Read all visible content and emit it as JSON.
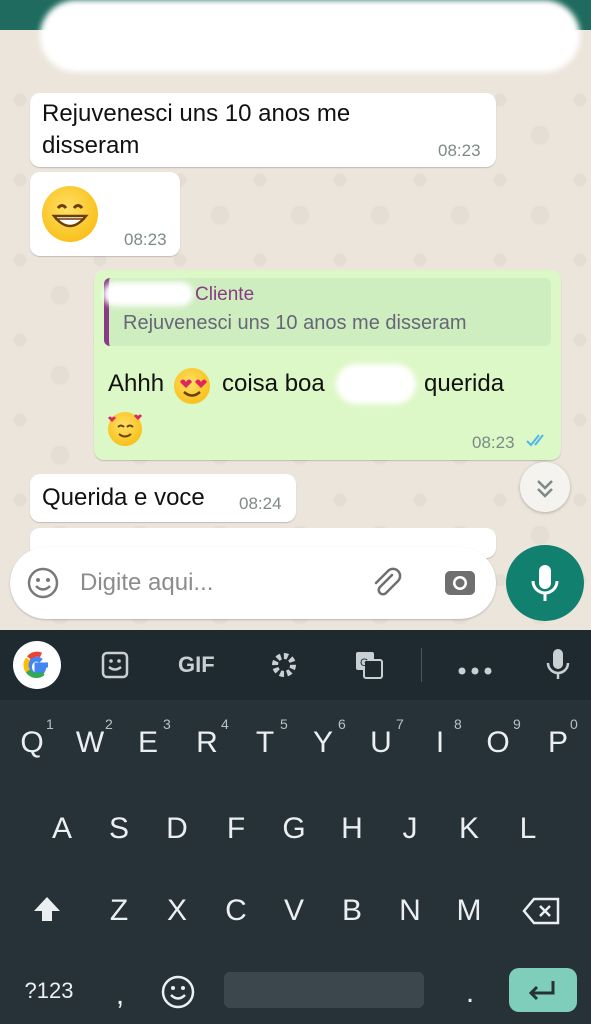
{
  "messages": [
    {
      "text": "Rejuvenesci uns 10 anos me disseram",
      "time": "08:23"
    },
    {
      "emoji": "grinning-face",
      "time": "08:23"
    },
    {
      "reply_author": "Cliente",
      "reply_text": "Rejuvenesci uns 10 anos me disseram",
      "text_before": "Ahhh",
      "text_mid": "coisa boa",
      "text_after": "querida",
      "time": "08:23"
    },
    {
      "text": "Querida e voce",
      "time": "08:24"
    }
  ],
  "composer": {
    "placeholder": "Digite aqui..."
  },
  "keyboard": {
    "toolbar": {
      "gif": "GIF"
    },
    "row1": [
      {
        "key": "Q",
        "hint": "1"
      },
      {
        "key": "W",
        "hint": "2"
      },
      {
        "key": "E",
        "hint": "3"
      },
      {
        "key": "R",
        "hint": "4"
      },
      {
        "key": "T",
        "hint": "5"
      },
      {
        "key": "Y",
        "hint": "6"
      },
      {
        "key": "U",
        "hint": "7"
      },
      {
        "key": "I",
        "hint": "8"
      },
      {
        "key": "O",
        "hint": "9"
      },
      {
        "key": "P",
        "hint": "0"
      }
    ],
    "row2": [
      "A",
      "S",
      "D",
      "F",
      "G",
      "H",
      "J",
      "K",
      "L"
    ],
    "row3": [
      "Z",
      "X",
      "C",
      "V",
      "B",
      "N",
      "M"
    ],
    "bottom": {
      "symbols": "?123",
      "comma": ",",
      "period": "."
    }
  },
  "colors": {
    "chat_bg": "#ece5dc",
    "outgoing": "#dcf8c6",
    "accent": "#12806e",
    "reply_author": "#8a3b86",
    "read_ticks": "#4fb6ec"
  }
}
